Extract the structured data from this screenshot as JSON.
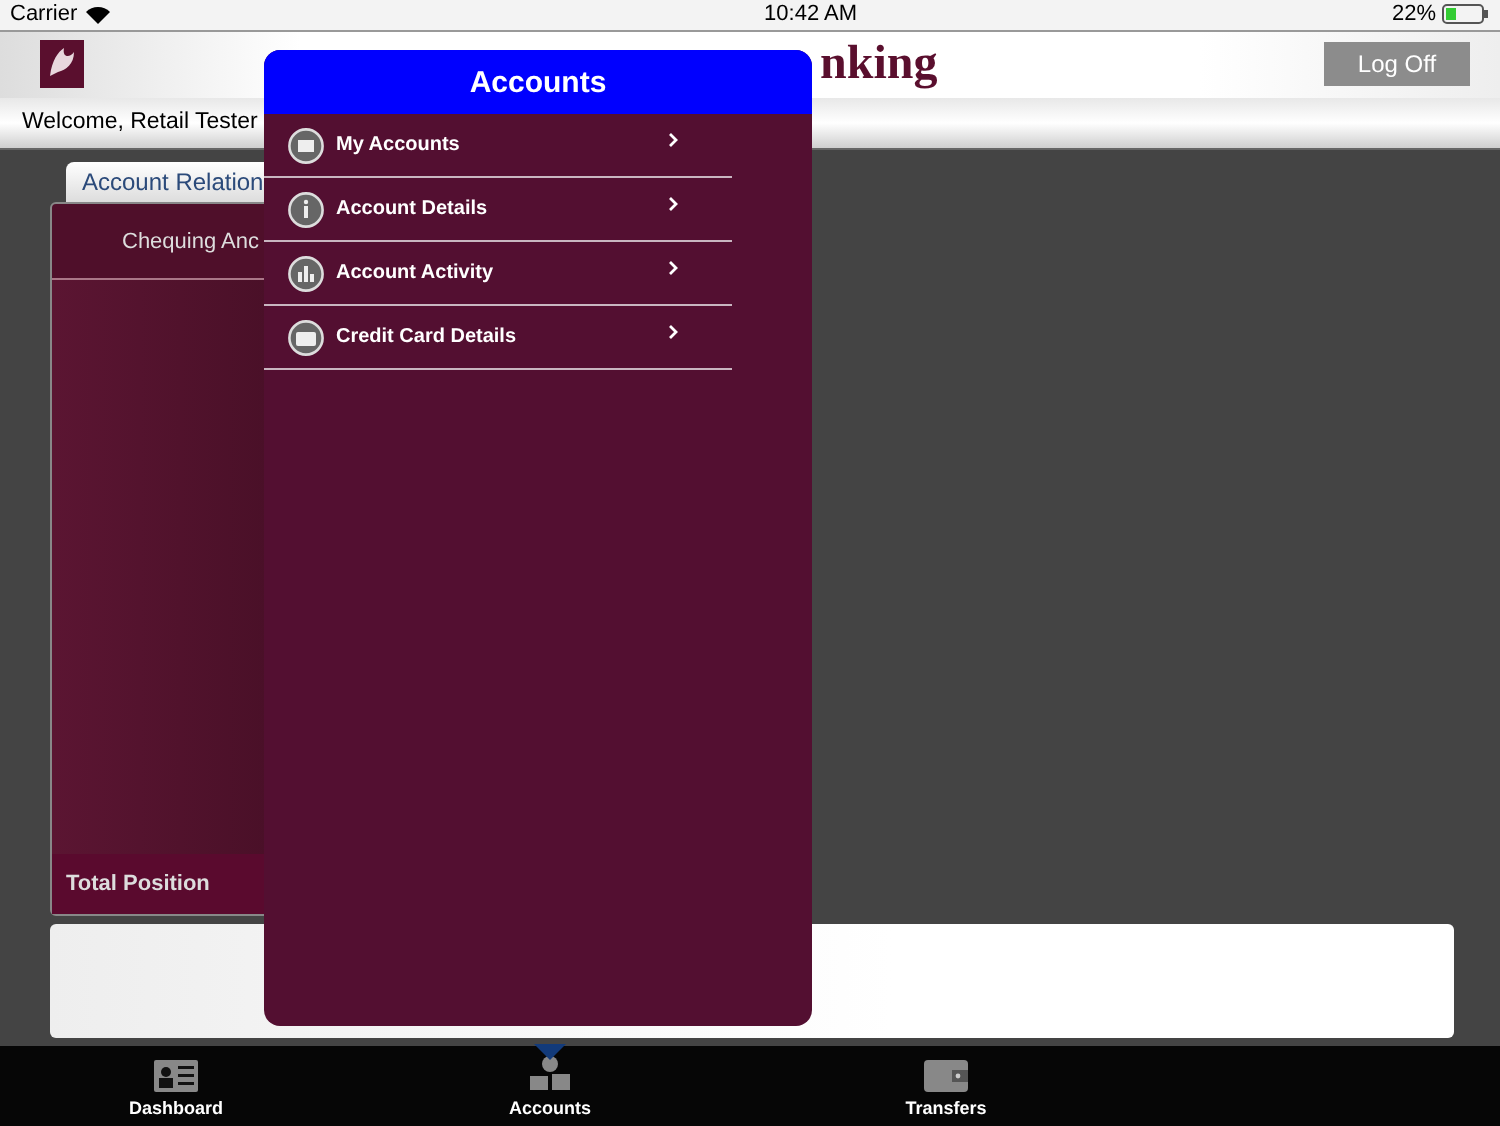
{
  "status_bar": {
    "carrier": "Carrier",
    "time": "10:42 AM",
    "battery": "22%"
  },
  "header": {
    "title_visible": "nking",
    "log_off": "Log Off"
  },
  "welcome": "Welcome, Retail Tester",
  "tab": {
    "label": "Account Relation"
  },
  "panel": {
    "column_1": "Chequing  Anc",
    "total": "Total Position"
  },
  "popover": {
    "title": "Accounts",
    "items": [
      {
        "label": "My Accounts"
      },
      {
        "label": "Account Details"
      },
      {
        "label": "Account Activity"
      },
      {
        "label": "Credit Card Details"
      }
    ]
  },
  "tab_bar": [
    {
      "label": "Dashboard",
      "selected": false
    },
    {
      "label": "Accounts",
      "selected": true
    },
    {
      "label": "Transfers",
      "selected": false
    }
  ]
}
